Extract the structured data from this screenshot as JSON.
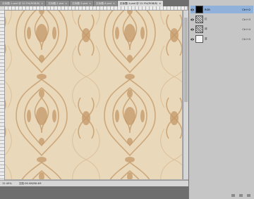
{
  "tabs": [
    {
      "label": "无标题-1.psd @ 12.5%(RGB/8)",
      "active": false
    },
    {
      "label": "无标题-2.psd",
      "active": false
    },
    {
      "label": "无标题-3.psd",
      "active": false
    },
    {
      "label": "无标题-4.psd",
      "active": false
    },
    {
      "label": "无标题-1.psd @ 12.5%(RGB/8)",
      "active": true
    }
  ],
  "tab_close": "×",
  "status": {
    "zoom": "12.45%",
    "doc": "文档:26.0M/88.4M"
  },
  "layers": [
    {
      "name": "RGB",
      "shortcut": "Ctrl+2",
      "thumb": "black",
      "selected": true
    },
    {
      "name": "红",
      "shortcut": "Ctrl+3",
      "thumb": "pattern",
      "selected": false
    },
    {
      "name": "绿",
      "shortcut": "Ctrl+4",
      "thumb": "pattern",
      "selected": false
    },
    {
      "name": "蓝",
      "shortcut": "Ctrl+5",
      "thumb": "plain",
      "selected": false
    }
  ],
  "colors": {
    "canvas_bg": "#ead8bb",
    "ornament": "#c9a273",
    "selected_row": "#8fb1da"
  }
}
